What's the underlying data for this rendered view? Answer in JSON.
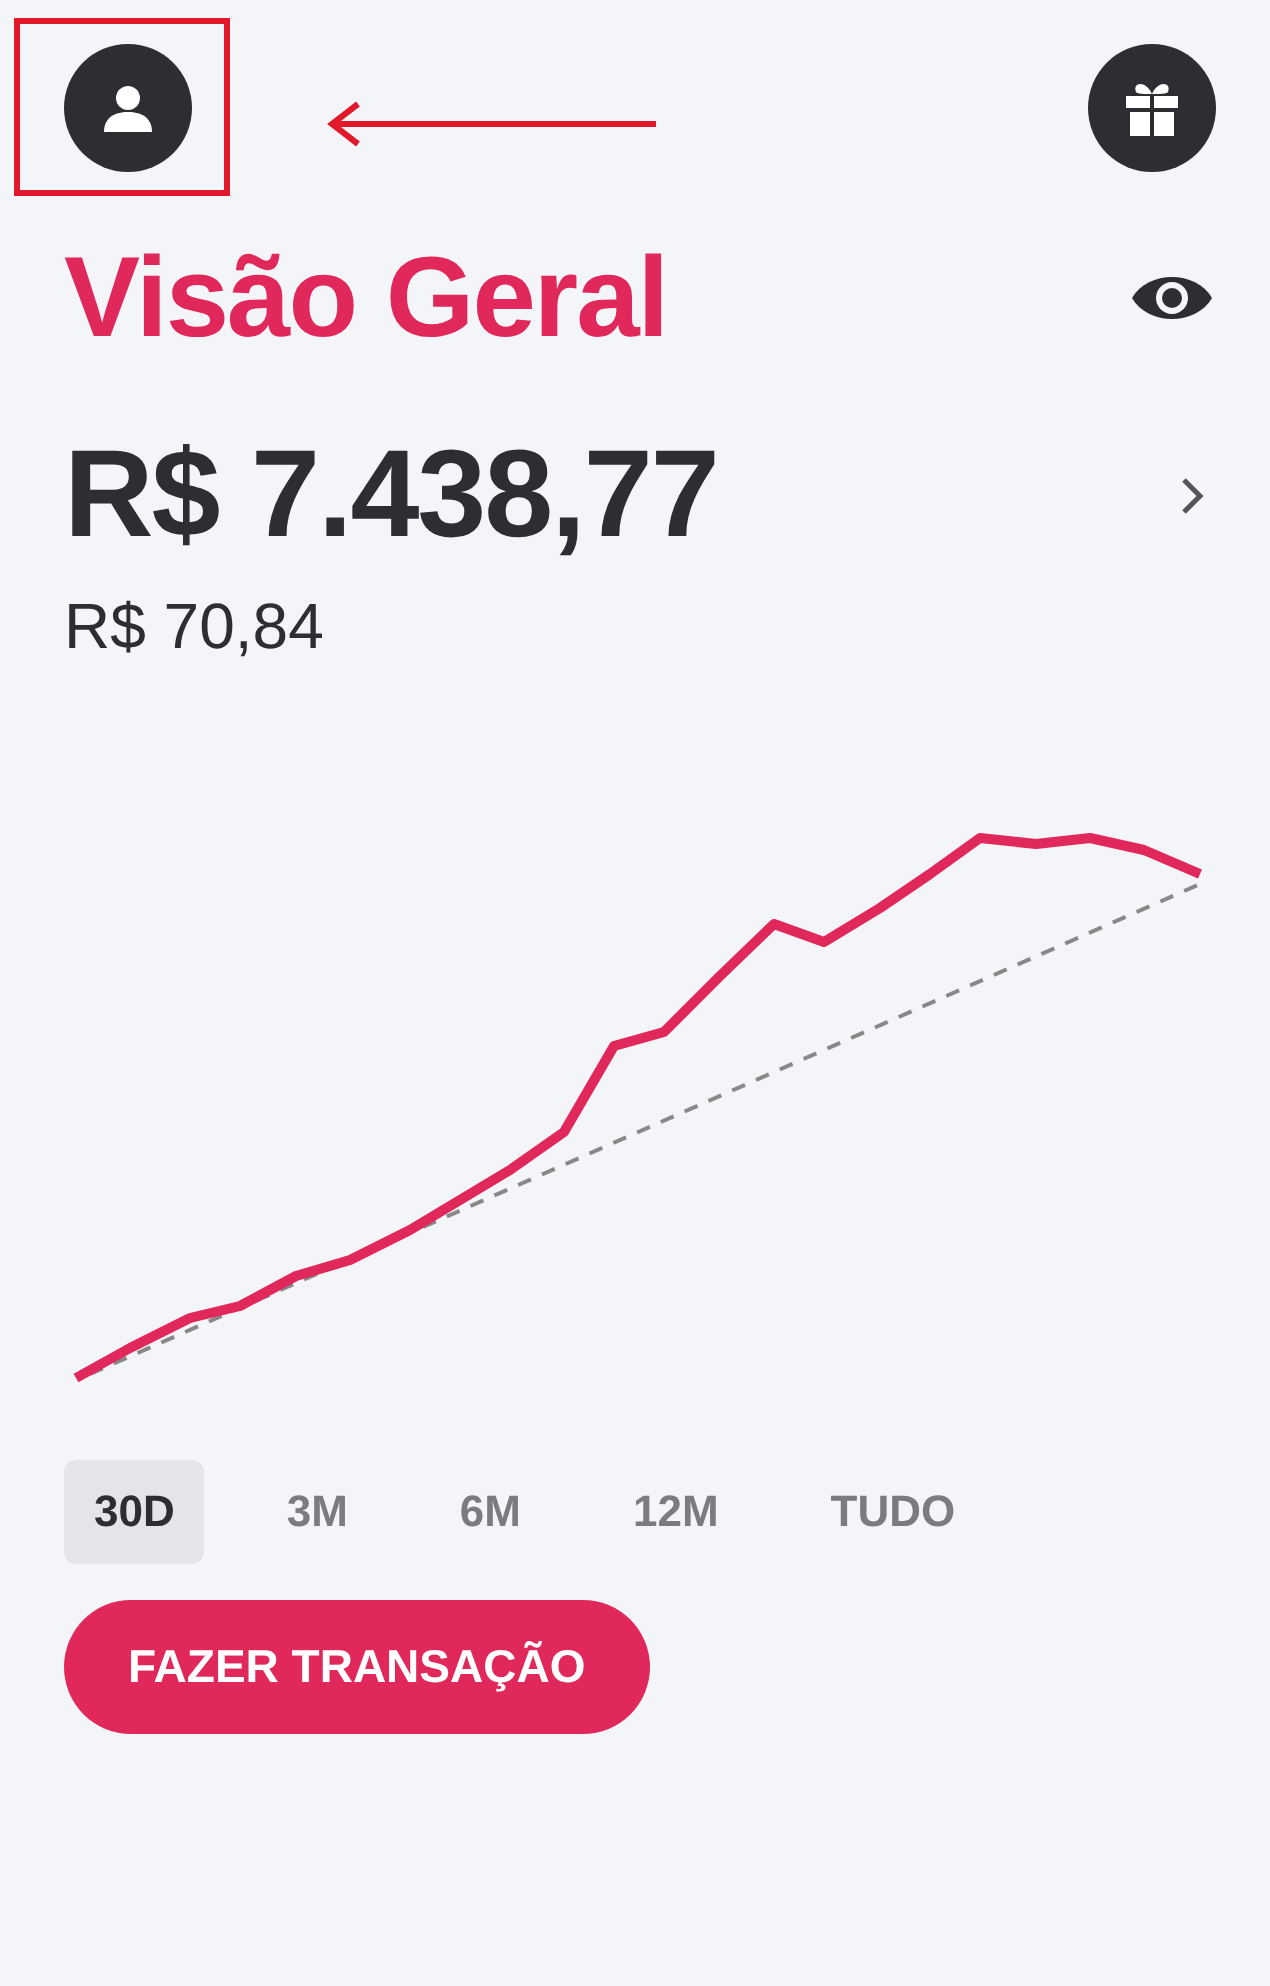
{
  "title": "Visão Geral",
  "balance": "R$ 7.438,77",
  "change": "R$ 70,84",
  "periods": [
    {
      "label": "30D",
      "selected": true
    },
    {
      "label": "3M",
      "selected": false
    },
    {
      "label": "6M",
      "selected": false
    },
    {
      "label": "12M",
      "selected": false
    },
    {
      "label": "TUDO",
      "selected": false
    }
  ],
  "action_button": "FAZER TRANSAÇÃO"
}
